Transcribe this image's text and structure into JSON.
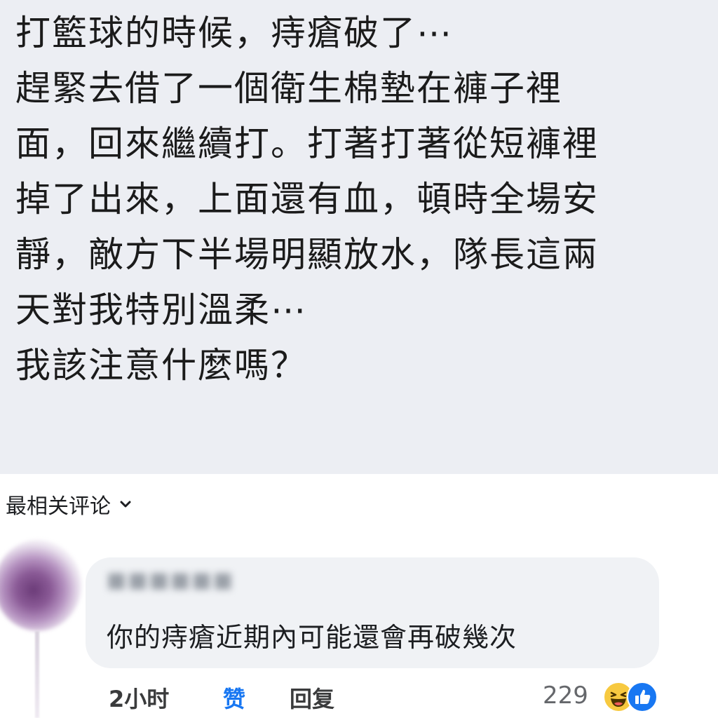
{
  "post": {
    "lines": [
      "打籃球的時候，痔瘡破了⋯",
      "趕緊去借了一個衛生棉墊在褲子裡",
      "面，回來繼續打。打著打著從短褲裡",
      "掉了出來，上面還有血，頓時全場安",
      "靜，敵方下半場明顯放水，隊長這兩",
      "天對我特別溫柔⋯",
      "我該注意什麼嗎？"
    ]
  },
  "comments_header": {
    "sort_label": "最相关评论",
    "icon": "chevron-down-icon"
  },
  "comment": {
    "text": "你的痔瘡近期內可能還會再破幾次",
    "time": "2小时",
    "like_label": "赞",
    "reply_label": "回复",
    "reaction_count": "229",
    "reaction_icons": [
      "haha-icon",
      "like-icon"
    ]
  },
  "colors": {
    "post_background": "#eceef3",
    "bubble_background": "#f0f2f5",
    "accent": "#1877f2",
    "haha": "#f7c940"
  }
}
